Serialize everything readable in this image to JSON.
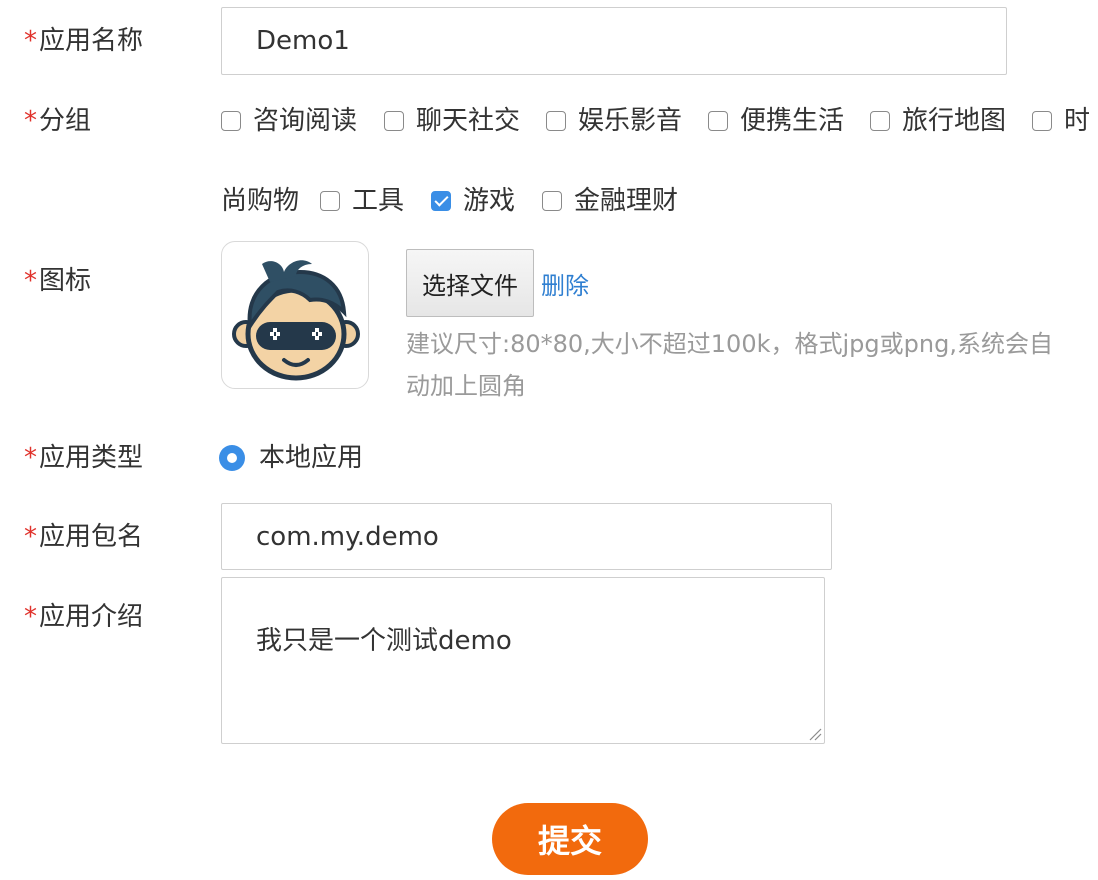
{
  "required_mark": "*",
  "form": {
    "app_name": {
      "label": "应用名称",
      "value": "Demo1"
    },
    "group": {
      "label": "分组",
      "options": [
        {
          "label": "咨询阅读",
          "checked": false
        },
        {
          "label": "聊天社交",
          "checked": false
        },
        {
          "label": "娱乐影音",
          "checked": false
        },
        {
          "label": "便携生活",
          "checked": false
        },
        {
          "label": "旅行地图",
          "checked": false
        },
        {
          "label": "时",
          "checked": false
        },
        {
          "label": "尚购物",
          "continuation": true
        },
        {
          "label": "工具",
          "checked": false
        },
        {
          "label": "游戏",
          "checked": true
        },
        {
          "label": "金融理财",
          "checked": false
        }
      ]
    },
    "icon": {
      "label": "图标",
      "choose_file_label": "选择文件",
      "delete_label": "删除",
      "hint_line1": "建议尺寸:80*80,大小不超过100k，格式jpg或png,系统会自",
      "hint_line2": "动加上圆角",
      "image": "cartoon-boy-with-mask-icon"
    },
    "app_type": {
      "label": "应用类型",
      "option": "本地应用",
      "selected": true
    },
    "package_name": {
      "label": "应用包名",
      "value": "com.my.demo"
    },
    "description": {
      "label": "应用介绍",
      "value": "我只是一个测试demo"
    },
    "submit_label": "提交"
  },
  "colors": {
    "required_star": "#e0322b",
    "accent_blue": "#3a8ee6",
    "link_blue": "#2f7fd1",
    "submit_orange": "#f26a0d",
    "hint_gray": "#9a9a9a"
  }
}
